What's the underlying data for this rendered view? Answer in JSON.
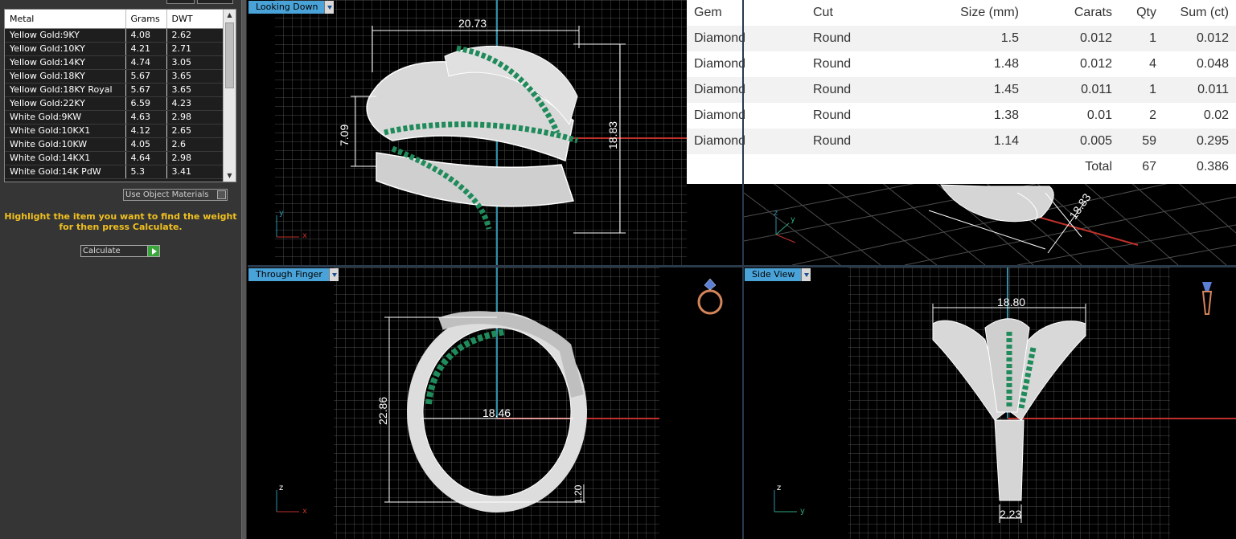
{
  "metal_table": {
    "headers": [
      "Metal",
      "Grams",
      "DWT"
    ],
    "rows": [
      {
        "metal": "Yellow Gold:9KY",
        "grams": "4.08",
        "dwt": "2.62"
      },
      {
        "metal": "Yellow Gold:10KY",
        "grams": "4.21",
        "dwt": "2.71"
      },
      {
        "metal": "Yellow Gold:14KY",
        "grams": "4.74",
        "dwt": "3.05"
      },
      {
        "metal": "Yellow Gold:18KY",
        "grams": "5.67",
        "dwt": "3.65"
      },
      {
        "metal": "Yellow Gold:18KY Royal",
        "grams": "5.67",
        "dwt": "3.65"
      },
      {
        "metal": "Yellow Gold:22KY",
        "grams": "6.59",
        "dwt": "4.23"
      },
      {
        "metal": "White Gold:9KW",
        "grams": "4.63",
        "dwt": "2.98"
      },
      {
        "metal": "White Gold:10KX1",
        "grams": "4.12",
        "dwt": "2.65"
      },
      {
        "metal": "White Gold:10KW",
        "grams": "4.05",
        "dwt": "2.6"
      },
      {
        "metal": "White Gold:14KX1",
        "grams": "4.64",
        "dwt": "2.98"
      },
      {
        "metal": "White Gold:14K PdW",
        "grams": "5.3",
        "dwt": "3.41"
      }
    ]
  },
  "left_panel": {
    "use_object_materials_label": "Use Object Materials",
    "hint": "Highlight the item you want to find the weight\nfor then press Calculate.",
    "calculate_label": "Calculate"
  },
  "viewports": {
    "top": {
      "label": "Looking Down",
      "dims": {
        "width": "20.73",
        "height": "18.83",
        "depth": "7.09"
      }
    },
    "perspective": {
      "dims": {
        "a": "18.83"
      }
    },
    "front": {
      "label": "Through Finger",
      "dims": {
        "height": "22.86",
        "inner": "18.46",
        "thickness": "1.20"
      }
    },
    "side": {
      "label": "Side View",
      "dims": {
        "width": "18.80",
        "shank": "2.23"
      }
    }
  },
  "gem_table": {
    "headers": [
      "Gem",
      "Cut",
      "Size (mm)",
      "Carats",
      "Qty",
      "Sum (ct)"
    ],
    "rows": [
      {
        "gem": "Diamond",
        "cut": "Round",
        "size": "1.5",
        "carats": "0.012",
        "qty": "1",
        "sum": "0.012"
      },
      {
        "gem": "Diamond",
        "cut": "Round",
        "size": "1.48",
        "carats": "0.012",
        "qty": "4",
        "sum": "0.048"
      },
      {
        "gem": "Diamond",
        "cut": "Round",
        "size": "1.45",
        "carats": "0.011",
        "qty": "1",
        "sum": "0.011"
      },
      {
        "gem": "Diamond",
        "cut": "Round",
        "size": "1.38",
        "carats": "0.01",
        "qty": "2",
        "sum": "0.02"
      },
      {
        "gem": "Diamond",
        "cut": "Round",
        "size": "1.14",
        "carats": "0.005",
        "qty": "59",
        "sum": "0.295"
      }
    ],
    "total_label": "Total",
    "total_qty": "67",
    "total_sum": "0.386"
  },
  "colors": {
    "panel_bg": "#353535",
    "grid": "#5a5a5a",
    "viewport_label_bg": "#4aa3d8",
    "hint": "#f0c020",
    "gem_green": "#1f8a5a",
    "axis_x": "#c0302a",
    "axis_y": "#2f8fa8"
  },
  "icons": [
    "ring-top-icon",
    "ring-side-icon",
    "dropdown-arrow-icon",
    "play-icon",
    "scroll-up-icon",
    "scroll-down-icon"
  ]
}
